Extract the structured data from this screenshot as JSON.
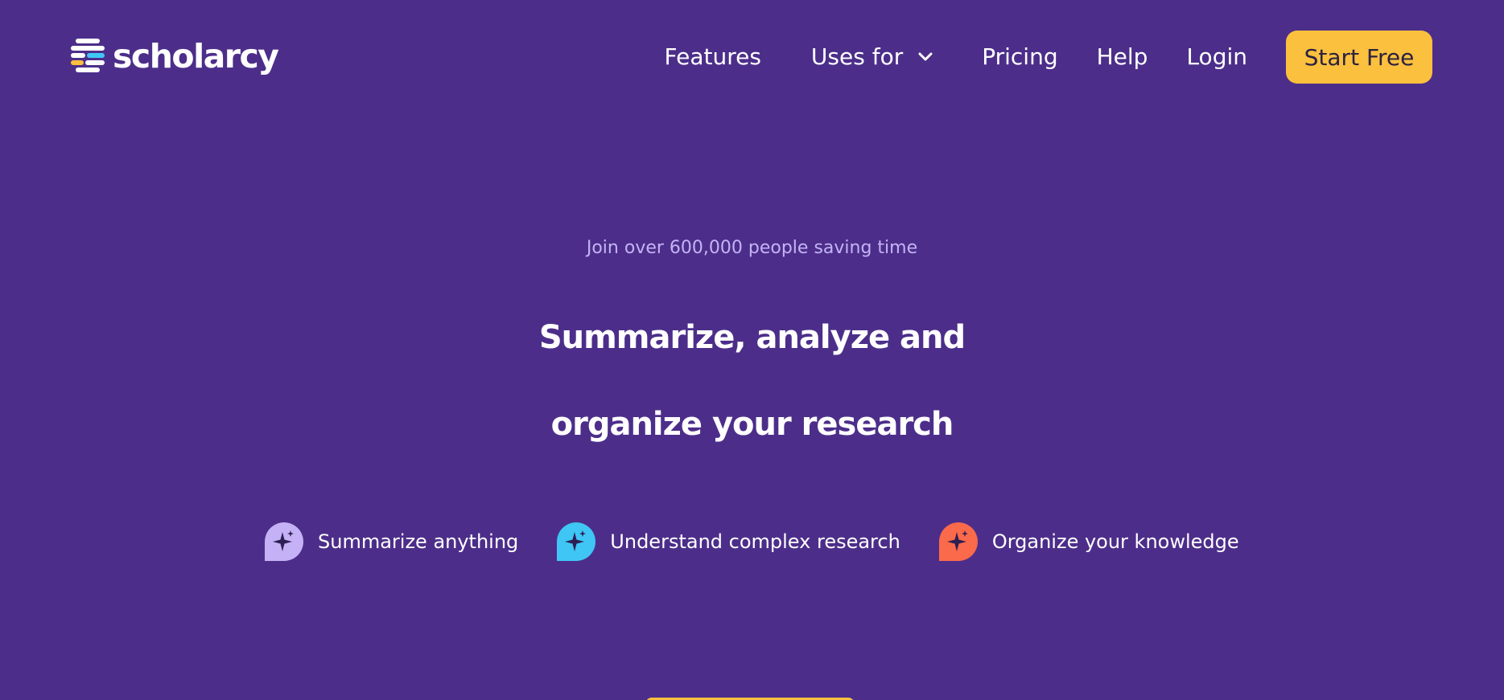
{
  "header": {
    "logo_text": "scholarcy",
    "nav": {
      "features": "Features",
      "uses_for": "Uses for",
      "pricing": "Pricing",
      "help": "Help",
      "login": "Login",
      "start_free": "Start Free"
    }
  },
  "hero": {
    "tagline": "Join over 600,000 people saving time",
    "headline_line1": "Summarize, analyze and",
    "headline_line2": "organize your research",
    "features": [
      {
        "label": "Summarize anything",
        "icon": "sparkle-bubble-icon",
        "color": "#c5b2f6"
      },
      {
        "label": "Understand complex research",
        "icon": "sparkle-bubble-icon",
        "color": "#3fc6f4"
      },
      {
        "label": "Organize your knowledge",
        "icon": "sparkle-bubble-icon",
        "color": "#fb6a4a"
      }
    ]
  },
  "colors": {
    "background": "#4c2e8a",
    "accent": "#fbc03d",
    "tagline": "#c4b3f5"
  }
}
